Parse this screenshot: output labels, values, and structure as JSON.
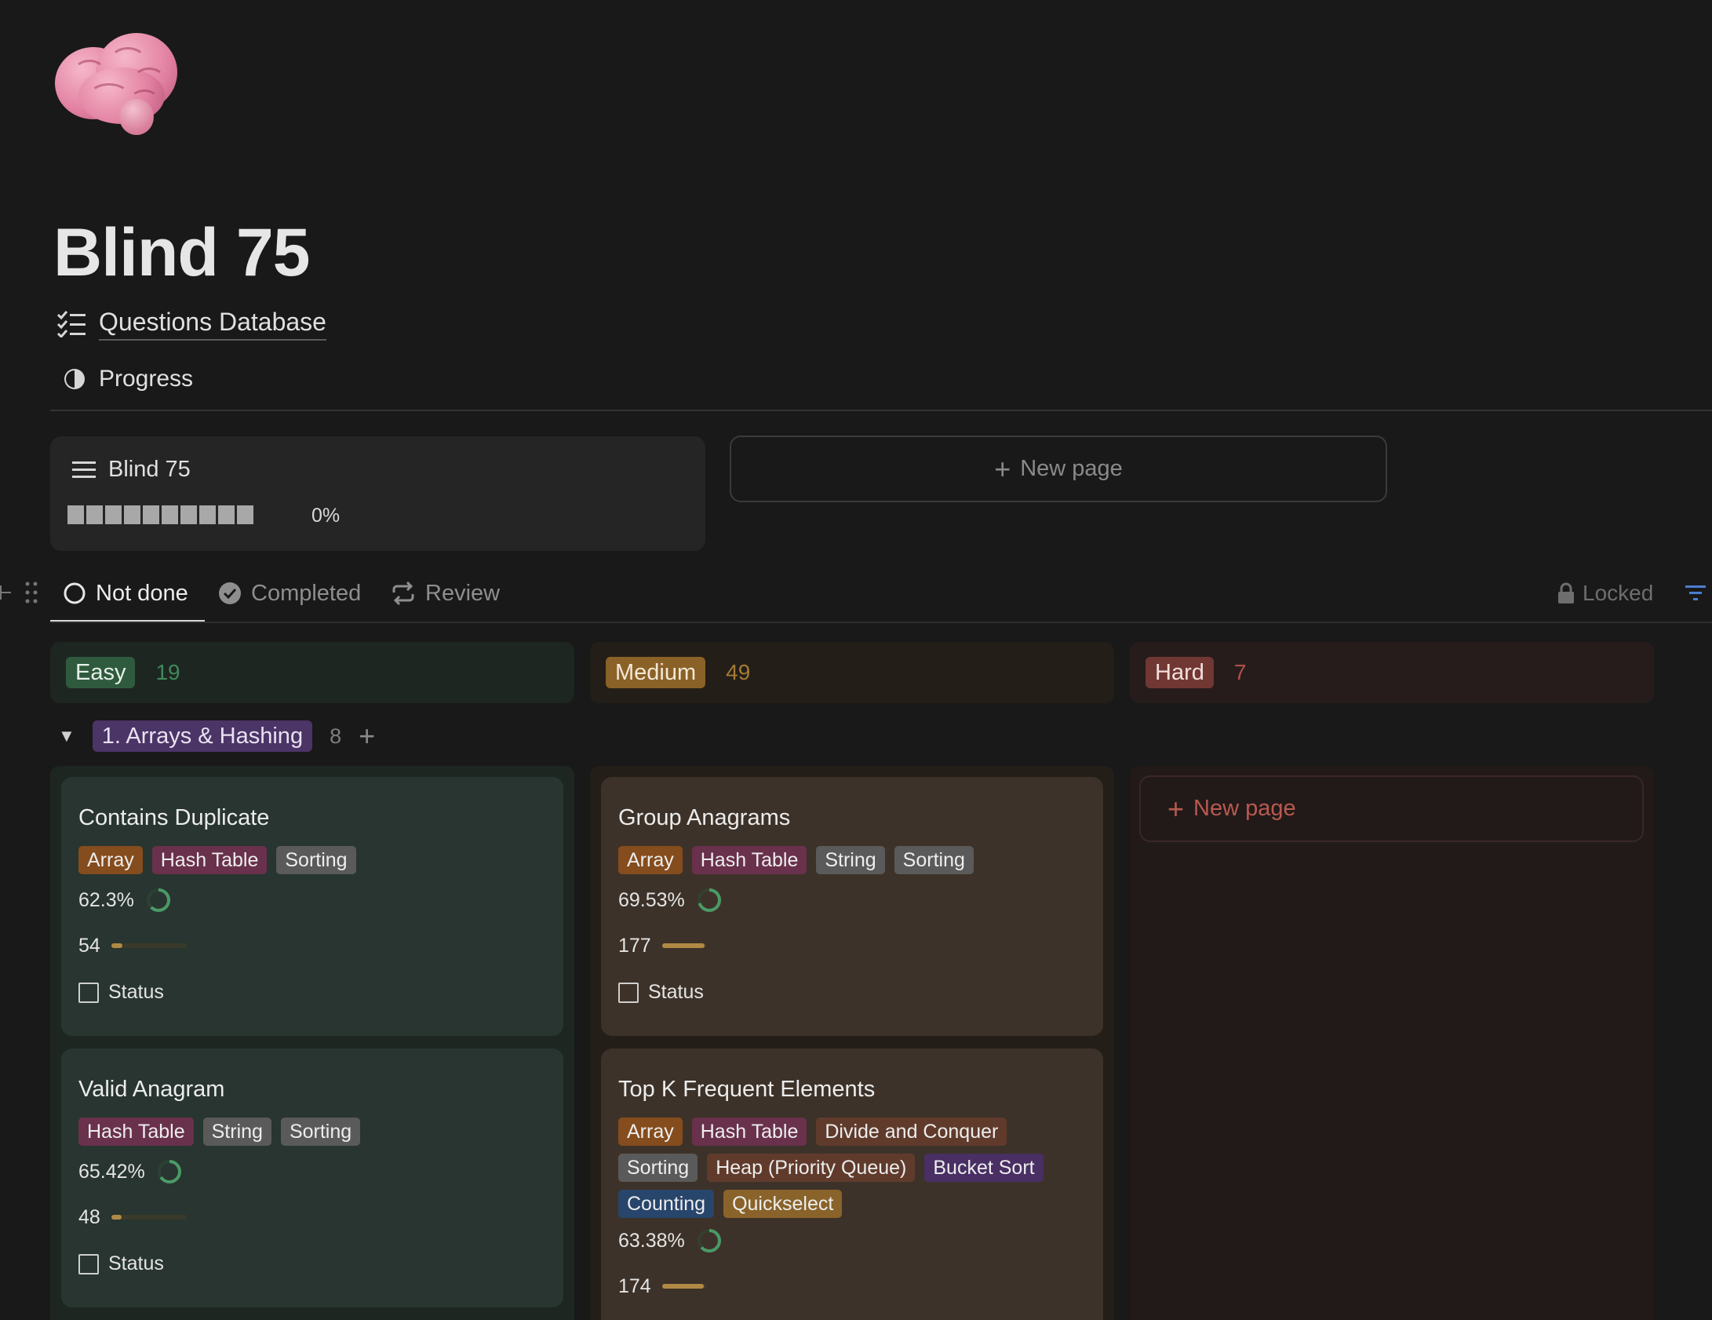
{
  "page": {
    "title": "Blind 75",
    "icon": "brain-icon",
    "links": [
      {
        "label": "Questions Database",
        "icon": "checklist-icon"
      },
      {
        "label": "Progress",
        "icon": "half-circle-icon"
      }
    ]
  },
  "progress_card": {
    "title": "Blind 75",
    "icon": "list-icon",
    "percent_label": "0%",
    "percent": 0
  },
  "new_page_label": "New page",
  "tabs": [
    {
      "label": "Not done",
      "icon": "circle-icon",
      "active": true
    },
    {
      "label": "Completed",
      "icon": "check-circle-icon",
      "active": false
    },
    {
      "label": "Review",
      "icon": "repeat-icon",
      "active": false
    }
  ],
  "locked_label": "Locked",
  "colors": {
    "easy": "#2f4a39",
    "medium": "#7f5a22",
    "hard": "#6b3530",
    "accent_filter": "#4a7fd1"
  },
  "columns": [
    {
      "label": "Easy",
      "count": "19"
    },
    {
      "label": "Medium",
      "count": "49"
    },
    {
      "label": "Hard",
      "count": "7"
    }
  ],
  "group": {
    "label": "1. Arrays & Hashing",
    "count": "8"
  },
  "cards": {
    "easy": [
      {
        "title": "Contains Duplicate",
        "tags": [
          "Array",
          "Hash Table",
          "Sorting"
        ],
        "acceptance": "62.3%",
        "acceptance_value": 62.3,
        "likes": "54",
        "status": "Status"
      },
      {
        "title": "Valid Anagram",
        "tags": [
          "Hash Table",
          "String",
          "Sorting"
        ],
        "acceptance": "65.42%",
        "acceptance_value": 65.42,
        "likes": "48",
        "status": "Status"
      }
    ],
    "medium": [
      {
        "title": "Group Anagrams",
        "tags": [
          "Array",
          "Hash Table",
          "String",
          "Sorting"
        ],
        "acceptance": "69.53%",
        "acceptance_value": 69.53,
        "likes": "177",
        "status": "Status"
      },
      {
        "title": "Top K Frequent Elements",
        "tags": [
          "Array",
          "Hash Table",
          "Divide and Conquer",
          "Sorting",
          "Heap (Priority Queue)",
          "Bucket Sort",
          "Counting",
          "Quickselect"
        ],
        "acceptance": "63.38%",
        "acceptance_value": 63.38,
        "likes": "174"
      }
    ]
  }
}
